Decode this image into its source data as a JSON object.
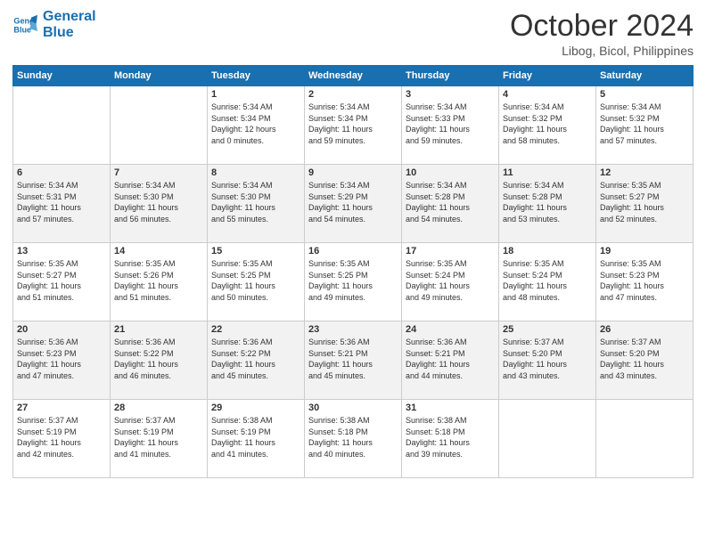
{
  "header": {
    "logo_line1": "General",
    "logo_line2": "Blue",
    "month": "October 2024",
    "location": "Libog, Bicol, Philippines"
  },
  "days_of_week": [
    "Sunday",
    "Monday",
    "Tuesday",
    "Wednesday",
    "Thursday",
    "Friday",
    "Saturday"
  ],
  "weeks": [
    [
      {
        "day": "",
        "info": ""
      },
      {
        "day": "",
        "info": ""
      },
      {
        "day": "1",
        "info": "Sunrise: 5:34 AM\nSunset: 5:34 PM\nDaylight: 12 hours\nand 0 minutes."
      },
      {
        "day": "2",
        "info": "Sunrise: 5:34 AM\nSunset: 5:34 PM\nDaylight: 11 hours\nand 59 minutes."
      },
      {
        "day": "3",
        "info": "Sunrise: 5:34 AM\nSunset: 5:33 PM\nDaylight: 11 hours\nand 59 minutes."
      },
      {
        "day": "4",
        "info": "Sunrise: 5:34 AM\nSunset: 5:32 PM\nDaylight: 11 hours\nand 58 minutes."
      },
      {
        "day": "5",
        "info": "Sunrise: 5:34 AM\nSunset: 5:32 PM\nDaylight: 11 hours\nand 57 minutes."
      }
    ],
    [
      {
        "day": "6",
        "info": "Sunrise: 5:34 AM\nSunset: 5:31 PM\nDaylight: 11 hours\nand 57 minutes."
      },
      {
        "day": "7",
        "info": "Sunrise: 5:34 AM\nSunset: 5:30 PM\nDaylight: 11 hours\nand 56 minutes."
      },
      {
        "day": "8",
        "info": "Sunrise: 5:34 AM\nSunset: 5:30 PM\nDaylight: 11 hours\nand 55 minutes."
      },
      {
        "day": "9",
        "info": "Sunrise: 5:34 AM\nSunset: 5:29 PM\nDaylight: 11 hours\nand 54 minutes."
      },
      {
        "day": "10",
        "info": "Sunrise: 5:34 AM\nSunset: 5:28 PM\nDaylight: 11 hours\nand 54 minutes."
      },
      {
        "day": "11",
        "info": "Sunrise: 5:34 AM\nSunset: 5:28 PM\nDaylight: 11 hours\nand 53 minutes."
      },
      {
        "day": "12",
        "info": "Sunrise: 5:35 AM\nSunset: 5:27 PM\nDaylight: 11 hours\nand 52 minutes."
      }
    ],
    [
      {
        "day": "13",
        "info": "Sunrise: 5:35 AM\nSunset: 5:27 PM\nDaylight: 11 hours\nand 51 minutes."
      },
      {
        "day": "14",
        "info": "Sunrise: 5:35 AM\nSunset: 5:26 PM\nDaylight: 11 hours\nand 51 minutes."
      },
      {
        "day": "15",
        "info": "Sunrise: 5:35 AM\nSunset: 5:25 PM\nDaylight: 11 hours\nand 50 minutes."
      },
      {
        "day": "16",
        "info": "Sunrise: 5:35 AM\nSunset: 5:25 PM\nDaylight: 11 hours\nand 49 minutes."
      },
      {
        "day": "17",
        "info": "Sunrise: 5:35 AM\nSunset: 5:24 PM\nDaylight: 11 hours\nand 49 minutes."
      },
      {
        "day": "18",
        "info": "Sunrise: 5:35 AM\nSunset: 5:24 PM\nDaylight: 11 hours\nand 48 minutes."
      },
      {
        "day": "19",
        "info": "Sunrise: 5:35 AM\nSunset: 5:23 PM\nDaylight: 11 hours\nand 47 minutes."
      }
    ],
    [
      {
        "day": "20",
        "info": "Sunrise: 5:36 AM\nSunset: 5:23 PM\nDaylight: 11 hours\nand 47 minutes."
      },
      {
        "day": "21",
        "info": "Sunrise: 5:36 AM\nSunset: 5:22 PM\nDaylight: 11 hours\nand 46 minutes."
      },
      {
        "day": "22",
        "info": "Sunrise: 5:36 AM\nSunset: 5:22 PM\nDaylight: 11 hours\nand 45 minutes."
      },
      {
        "day": "23",
        "info": "Sunrise: 5:36 AM\nSunset: 5:21 PM\nDaylight: 11 hours\nand 45 minutes."
      },
      {
        "day": "24",
        "info": "Sunrise: 5:36 AM\nSunset: 5:21 PM\nDaylight: 11 hours\nand 44 minutes."
      },
      {
        "day": "25",
        "info": "Sunrise: 5:37 AM\nSunset: 5:20 PM\nDaylight: 11 hours\nand 43 minutes."
      },
      {
        "day": "26",
        "info": "Sunrise: 5:37 AM\nSunset: 5:20 PM\nDaylight: 11 hours\nand 43 minutes."
      }
    ],
    [
      {
        "day": "27",
        "info": "Sunrise: 5:37 AM\nSunset: 5:19 PM\nDaylight: 11 hours\nand 42 minutes."
      },
      {
        "day": "28",
        "info": "Sunrise: 5:37 AM\nSunset: 5:19 PM\nDaylight: 11 hours\nand 41 minutes."
      },
      {
        "day": "29",
        "info": "Sunrise: 5:38 AM\nSunset: 5:19 PM\nDaylight: 11 hours\nand 41 minutes."
      },
      {
        "day": "30",
        "info": "Sunrise: 5:38 AM\nSunset: 5:18 PM\nDaylight: 11 hours\nand 40 minutes."
      },
      {
        "day": "31",
        "info": "Sunrise: 5:38 AM\nSunset: 5:18 PM\nDaylight: 11 hours\nand 39 minutes."
      },
      {
        "day": "",
        "info": ""
      },
      {
        "day": "",
        "info": ""
      }
    ]
  ]
}
